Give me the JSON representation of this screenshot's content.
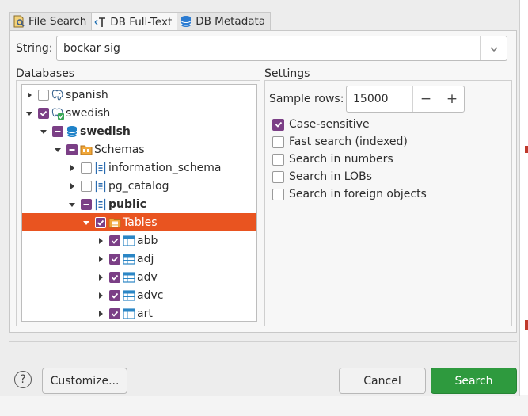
{
  "tabs": [
    {
      "label": "File Search",
      "icon": "file-search-icon",
      "active": false
    },
    {
      "label": "DB Full-Text",
      "icon": "db-fulltext-icon",
      "active": true
    },
    {
      "label": "DB Metadata",
      "icon": "db-metadata-icon",
      "active": false
    }
  ],
  "string_field": {
    "label": "String:",
    "value": "bockar sig"
  },
  "databases": {
    "label": "Databases",
    "tree": [
      {
        "label": "spanish",
        "depth": 0,
        "arrow": "collapsed",
        "check": "empty",
        "icon": "postgres-icon",
        "bold": false
      },
      {
        "label": "swedish",
        "depth": 0,
        "arrow": "expanded",
        "check": "checked",
        "icon": "postgres-connected-icon",
        "bold": false
      },
      {
        "label": "swedish",
        "depth": 1,
        "arrow": "expanded",
        "check": "partial",
        "icon": "database-icon",
        "bold": true
      },
      {
        "label": "Schemas",
        "depth": 2,
        "arrow": "expanded",
        "check": "partial",
        "icon": "schemas-folder-icon",
        "bold": false
      },
      {
        "label": "information_schema",
        "depth": 3,
        "arrow": "collapsed",
        "check": "empty",
        "icon": "schema-icon",
        "bold": false
      },
      {
        "label": "pg_catalog",
        "depth": 3,
        "arrow": "collapsed",
        "check": "empty",
        "icon": "schema-icon",
        "bold": false
      },
      {
        "label": "public",
        "depth": 3,
        "arrow": "expanded",
        "check": "partial",
        "icon": "schema-icon",
        "bold": true
      },
      {
        "label": "Tables",
        "depth": 4,
        "arrow": "expanded",
        "check": "checked",
        "icon": "tables-folder-icon",
        "bold": false,
        "selected": true
      },
      {
        "label": "abb",
        "depth": 5,
        "arrow": "collapsed",
        "check": "checked",
        "icon": "table-icon",
        "bold": false
      },
      {
        "label": "adj",
        "depth": 5,
        "arrow": "collapsed",
        "check": "checked",
        "icon": "table-icon",
        "bold": false
      },
      {
        "label": "adv",
        "depth": 5,
        "arrow": "collapsed",
        "check": "checked",
        "icon": "table-icon",
        "bold": false
      },
      {
        "label": "advc",
        "depth": 5,
        "arrow": "collapsed",
        "check": "checked",
        "icon": "table-icon",
        "bold": false
      },
      {
        "label": "art",
        "depth": 5,
        "arrow": "collapsed",
        "check": "checked",
        "icon": "table-icon",
        "bold": false
      }
    ]
  },
  "settings": {
    "label": "Settings",
    "sample_rows_label": "Sample rows:",
    "sample_rows_value": "15000",
    "minus": "−",
    "plus": "+",
    "options": [
      {
        "label": "Case-sensitive",
        "checked": true
      },
      {
        "label": "Fast search (indexed)",
        "checked": false
      },
      {
        "label": "Search in numbers",
        "checked": false
      },
      {
        "label": "Search in LOBs",
        "checked": false
      },
      {
        "label": "Search in foreign objects",
        "checked": false
      }
    ]
  },
  "footer": {
    "help": "?",
    "customize": "Customize...",
    "cancel": "Cancel",
    "search": "Search"
  },
  "colors": {
    "accent": "#e95420",
    "checkbox": "#7b3f86",
    "primary_button": "#2e9a3e"
  }
}
